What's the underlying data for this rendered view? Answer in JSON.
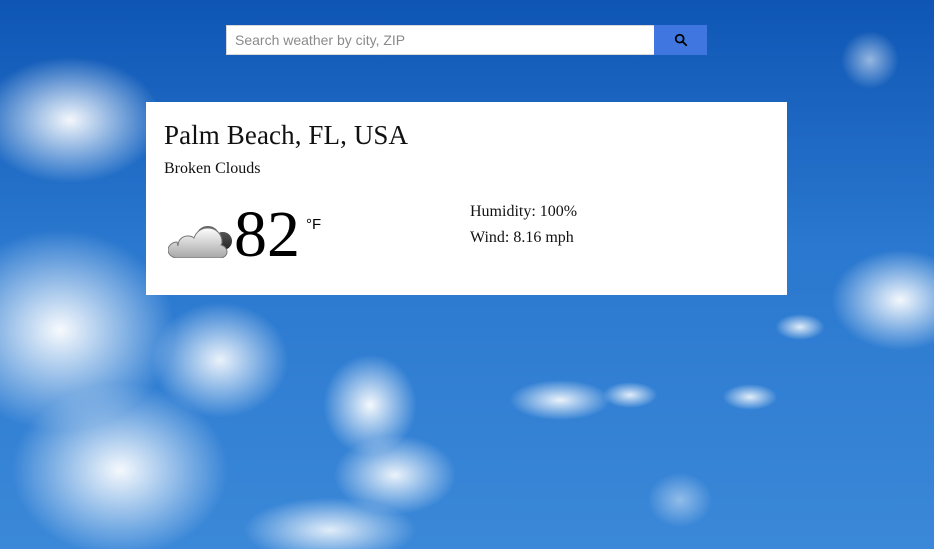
{
  "search": {
    "placeholder": "Search weather by city, ZIP",
    "value": ""
  },
  "weather": {
    "location": "Palm Beach, FL, USA",
    "description": "Broken Clouds",
    "temperature": "82",
    "unit": "°F",
    "humidity": "Humidity: 100%",
    "wind": "Wind: 8.16 mph",
    "icon": "broken-clouds-icon"
  },
  "colors": {
    "search_button": "#3f76df",
    "card_background": "#ffffff",
    "sky_blue": "#1f63b8"
  }
}
